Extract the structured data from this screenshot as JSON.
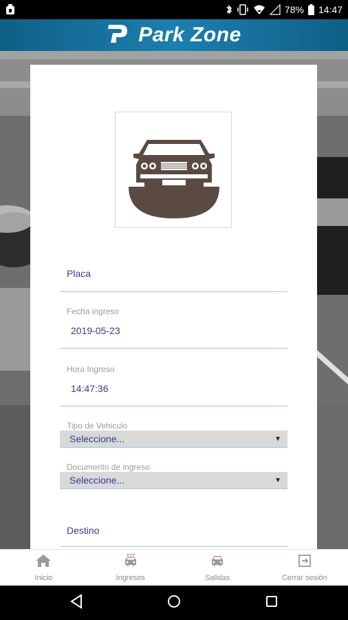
{
  "status_bar": {
    "battery": "78%",
    "time": "14:47",
    "icons": [
      "notification-icon",
      "bluetooth-icon",
      "vibrate-icon",
      "wifi-icon",
      "signal-icon",
      "battery-icon"
    ]
  },
  "header": {
    "logo_icon": "park-zone-logo-icon",
    "title": "Park Zone",
    "color": "#1a73a4"
  },
  "form": {
    "image_icon": "car-front-icon",
    "placa": {
      "label": "Placa"
    },
    "fecha_ingreso": {
      "label": "Fecha ingreso",
      "value": "2019-05-23"
    },
    "hora_ingreso": {
      "label": "Hora Ingreso",
      "value": "14:47:36"
    },
    "tipo_vehiculo": {
      "label": "Tipo de Vehiculo",
      "selected": "Seleccione..."
    },
    "documento_ingreso": {
      "label": "Documento de ingreso",
      "selected": "Seleccione..."
    },
    "destino": {
      "label": "Destino"
    }
  },
  "bottom_nav": {
    "items": [
      {
        "label": "Inicio",
        "icon": "home-icon"
      },
      {
        "label": "Ingresos",
        "icon": "car-in-icon"
      },
      {
        "label": "Salidas",
        "icon": "car-out-icon"
      },
      {
        "label": "Cerrar sesión",
        "icon": "logout-icon"
      }
    ]
  },
  "colors": {
    "field_text": "#3b3b8a",
    "underline": "#9cc5ee",
    "car": "#5a4a42"
  }
}
